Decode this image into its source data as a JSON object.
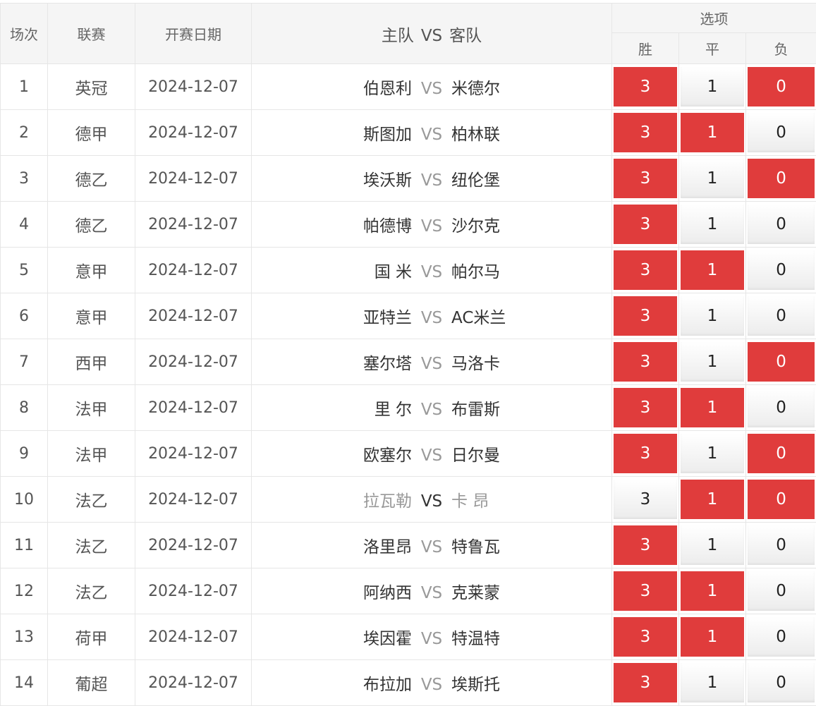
{
  "headers": {
    "index": "场次",
    "league": "联赛",
    "date": "开赛日期",
    "home": "主队",
    "vs": "VS",
    "away": "客队",
    "options": "选项",
    "win": "胜",
    "draw": "平",
    "lose": "负"
  },
  "colors": {
    "selected": "#e03c3c",
    "muted_text": "#999999"
  },
  "rows": [
    {
      "index": "1",
      "league": "英冠",
      "date": "2024-12-07",
      "home": "伯恩利",
      "vs": "VS",
      "away": "米德尔",
      "win": "3",
      "draw": "1",
      "lose": "0",
      "sel": [
        true,
        false,
        true
      ]
    },
    {
      "index": "2",
      "league": "德甲",
      "date": "2024-12-07",
      "home": "斯图加",
      "vs": "VS",
      "away": "柏林联",
      "win": "3",
      "draw": "1",
      "lose": "0",
      "sel": [
        true,
        true,
        false
      ]
    },
    {
      "index": "3",
      "league": "德乙",
      "date": "2024-12-07",
      "home": "埃沃斯",
      "vs": "VS",
      "away": "纽伦堡",
      "win": "3",
      "draw": "1",
      "lose": "0",
      "sel": [
        true,
        false,
        true
      ]
    },
    {
      "index": "4",
      "league": "德乙",
      "date": "2024-12-07",
      "home": "帕德博",
      "vs": "VS",
      "away": "沙尔克",
      "win": "3",
      "draw": "1",
      "lose": "0",
      "sel": [
        true,
        false,
        false
      ]
    },
    {
      "index": "5",
      "league": "意甲",
      "date": "2024-12-07",
      "home": "国 米",
      "vs": "VS",
      "away": "帕尔马",
      "win": "3",
      "draw": "1",
      "lose": "0",
      "sel": [
        true,
        true,
        false
      ]
    },
    {
      "index": "6",
      "league": "意甲",
      "date": "2024-12-07",
      "home": "亚特兰",
      "vs": "VS",
      "away": "AC米兰",
      "win": "3",
      "draw": "1",
      "lose": "0",
      "sel": [
        true,
        false,
        false
      ]
    },
    {
      "index": "7",
      "league": "西甲",
      "date": "2024-12-07",
      "home": "塞尔塔",
      "vs": "VS",
      "away": "马洛卡",
      "win": "3",
      "draw": "1",
      "lose": "0",
      "sel": [
        true,
        false,
        true
      ]
    },
    {
      "index": "8",
      "league": "法甲",
      "date": "2024-12-07",
      "home": "里 尔",
      "vs": "VS",
      "away": "布雷斯",
      "win": "3",
      "draw": "1",
      "lose": "0",
      "sel": [
        true,
        true,
        false
      ]
    },
    {
      "index": "9",
      "league": "法甲",
      "date": "2024-12-07",
      "home": "欧塞尔",
      "vs": "VS",
      "away": "日尔曼",
      "win": "3",
      "draw": "1",
      "lose": "0",
      "sel": [
        true,
        false,
        true
      ]
    },
    {
      "index": "10",
      "league": "法乙",
      "date": "2024-12-07",
      "home": "拉瓦勒",
      "vs": "VS",
      "away": "卡 昂",
      "win": "3",
      "draw": "1",
      "lose": "0",
      "sel": [
        false,
        true,
        true
      ],
      "muted": true
    },
    {
      "index": "11",
      "league": "法乙",
      "date": "2024-12-07",
      "home": "洛里昂",
      "vs": "VS",
      "away": "特鲁瓦",
      "win": "3",
      "draw": "1",
      "lose": "0",
      "sel": [
        true,
        false,
        false
      ]
    },
    {
      "index": "12",
      "league": "法乙",
      "date": "2024-12-07",
      "home": "阿纳西",
      "vs": "VS",
      "away": "克莱蒙",
      "win": "3",
      "draw": "1",
      "lose": "0",
      "sel": [
        true,
        true,
        false
      ]
    },
    {
      "index": "13",
      "league": "荷甲",
      "date": "2024-12-07",
      "home": "埃因霍",
      "vs": "VS",
      "away": "特温特",
      "win": "3",
      "draw": "1",
      "lose": "0",
      "sel": [
        true,
        true,
        false
      ]
    },
    {
      "index": "14",
      "league": "葡超",
      "date": "2024-12-07",
      "home": "布拉加",
      "vs": "VS",
      "away": "埃斯托",
      "win": "3",
      "draw": "1",
      "lose": "0",
      "sel": [
        true,
        false,
        false
      ]
    }
  ]
}
